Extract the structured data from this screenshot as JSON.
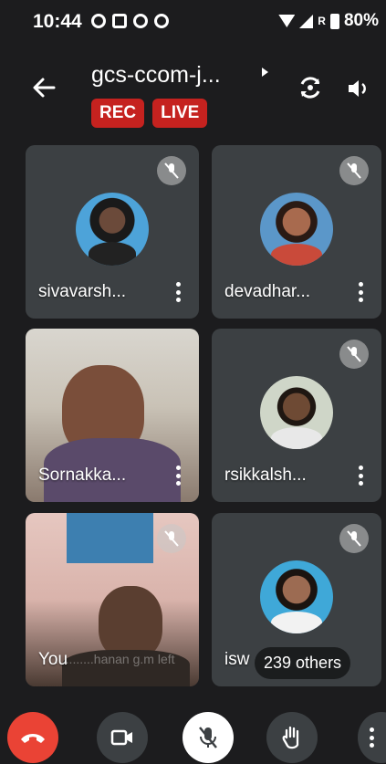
{
  "status_bar": {
    "time": "10:44",
    "battery": "80%",
    "network_mark": "R"
  },
  "meeting": {
    "title": "gcs-ccom-j...",
    "badge_rec": "REC",
    "badge_live": "LIVE"
  },
  "participants": [
    {
      "name": "sivavarsh...",
      "muted": true
    },
    {
      "name": "devadhar...",
      "muted": true
    },
    {
      "name": "Sornakka...",
      "muted": false
    },
    {
      "name": "rsikkalsh...",
      "muted": true
    },
    {
      "name": "You",
      "muted": true
    },
    {
      "name": "isw",
      "muted": true
    }
  ],
  "toast": "...........hanan g.m left",
  "others_label": "239 others",
  "colors": {
    "end_call": "#ea4335",
    "badge": "#c5221f",
    "tile": "#3c4043",
    "background": "#1c1c1e"
  },
  "controls": {
    "end_call_icon": "call-end-icon",
    "camera_icon": "videocam-icon",
    "mic_icon": "mic-off-icon",
    "hand_icon": "raise-hand-icon",
    "more_icon": "more-vert-icon"
  }
}
